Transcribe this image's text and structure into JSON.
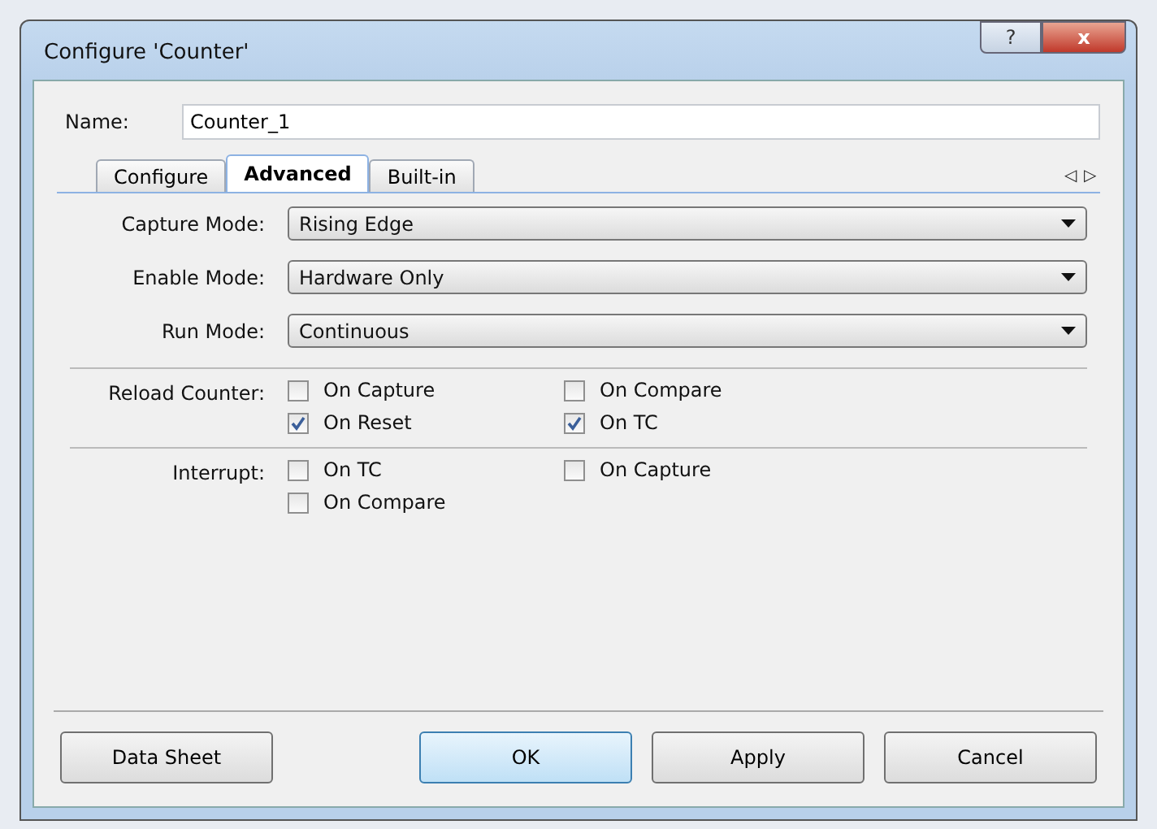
{
  "window": {
    "title": "Configure 'Counter'",
    "buttons": [
      {
        "kind": "help",
        "label": "?"
      },
      {
        "kind": "close",
        "label": "x"
      }
    ]
  },
  "name_field": {
    "label": "Name:",
    "value": "Counter_1"
  },
  "tabs": [
    {
      "label": "Configure",
      "selected": false
    },
    {
      "label": "Advanced",
      "selected": true
    },
    {
      "label": "Built-in",
      "selected": false
    }
  ],
  "tab_scroll": [
    "◁",
    "▷"
  ],
  "dropdowns": [
    {
      "label": "Capture Mode:",
      "value": "Rising Edge"
    },
    {
      "label": "Enable Mode:",
      "value": "Hardware Only"
    },
    {
      "label": "Run Mode:",
      "value": "Continuous"
    }
  ],
  "groups": [
    {
      "label": "Reload Counter:",
      "options": [
        {
          "label": "On Capture",
          "checked": false
        },
        {
          "label": "On Compare",
          "checked": false
        },
        {
          "label": "On Reset",
          "checked": true
        },
        {
          "label": "On TC",
          "checked": true
        }
      ]
    },
    {
      "label": "Interrupt:",
      "options": [
        {
          "label": "On TC",
          "checked": false
        },
        {
          "label": "On Capture",
          "checked": false
        },
        {
          "label": "On Compare",
          "checked": false
        }
      ]
    }
  ],
  "footer_buttons": [
    {
      "label": "Data Sheet",
      "default": false
    },
    {
      "label": "OK",
      "default": true
    },
    {
      "label": "Apply",
      "default": false
    },
    {
      "label": "Cancel",
      "default": false
    }
  ]
}
